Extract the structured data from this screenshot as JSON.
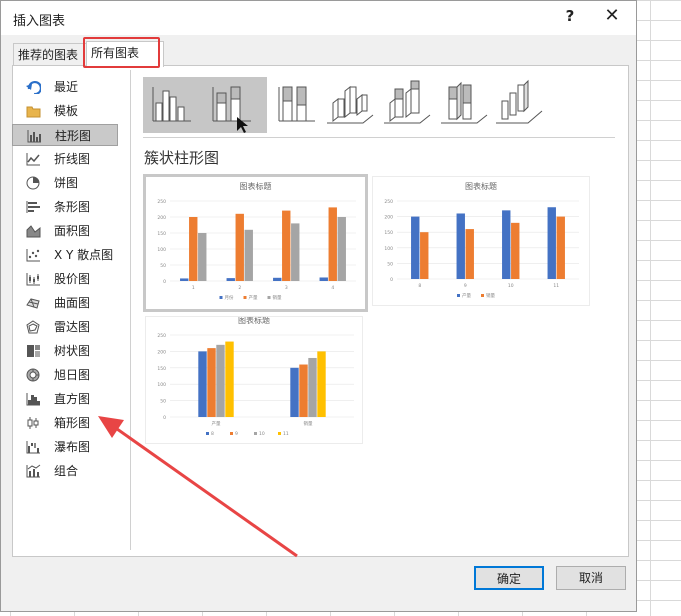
{
  "dialog": {
    "title": "插入图表",
    "help_label": "?",
    "close_label": "✕"
  },
  "tabs": [
    {
      "label": "推荐的图表",
      "selected": false
    },
    {
      "label": "所有图表",
      "selected": true
    }
  ],
  "sidebar": {
    "items": [
      {
        "label": "最近",
        "icon": "recent-icon"
      },
      {
        "label": "模板",
        "icon": "folder-icon"
      },
      {
        "label": "柱形图",
        "icon": "column-chart-icon",
        "selected": true
      },
      {
        "label": "折线图",
        "icon": "line-chart-icon"
      },
      {
        "label": "饼图",
        "icon": "pie-chart-icon"
      },
      {
        "label": "条形图",
        "icon": "bar-chart-icon"
      },
      {
        "label": "面积图",
        "icon": "area-chart-icon"
      },
      {
        "label": "X Y 散点图",
        "icon": "scatter-chart-icon"
      },
      {
        "label": "股价图",
        "icon": "stock-chart-icon"
      },
      {
        "label": "曲面图",
        "icon": "surface-chart-icon"
      },
      {
        "label": "雷达图",
        "icon": "radar-chart-icon"
      },
      {
        "label": "树状图",
        "icon": "treemap-chart-icon"
      },
      {
        "label": "旭日图",
        "icon": "sunburst-chart-icon"
      },
      {
        "label": "直方图",
        "icon": "histogram-chart-icon"
      },
      {
        "label": "箱形图",
        "icon": "boxplot-chart-icon"
      },
      {
        "label": "瀑布图",
        "icon": "waterfall-chart-icon"
      },
      {
        "label": "组合",
        "icon": "combo-chart-icon"
      }
    ]
  },
  "main": {
    "section_title": "簇状柱形图",
    "subtypes": [
      {
        "icon": "clustered-column-icon",
        "selected": true
      },
      {
        "icon": "stacked-column-icon",
        "selected": true
      },
      {
        "icon": "100-stacked-column-icon"
      },
      {
        "icon": "3d-clustered-column-icon"
      },
      {
        "icon": "3d-stacked-column-icon"
      },
      {
        "icon": "3d-100-stacked-column-icon"
      },
      {
        "icon": "3d-column-icon"
      }
    ],
    "previews": [
      {
        "title": "图表标题"
      },
      {
        "title": "图表标题"
      },
      {
        "title": "图表标题"
      }
    ]
  },
  "chart_data": [
    {
      "type": "bar",
      "title": "图表标题",
      "categories": [
        "1",
        "2",
        "3",
        "4"
      ],
      "series": [
        {
          "name": "月份",
          "color": "#4472c4",
          "values": [
            8,
            9,
            10,
            11
          ]
        },
        {
          "name": "产量",
          "color": "#ed7d31",
          "values": [
            200,
            210,
            220,
            230
          ]
        },
        {
          "name": "销量",
          "color": "#a5a5a5",
          "values": [
            150,
            160,
            180,
            200
          ]
        }
      ],
      "yticks": [
        "0",
        "50",
        "100",
        "150",
        "200",
        "250"
      ],
      "ylim": [
        0,
        250
      ]
    },
    {
      "type": "bar",
      "title": "图表标题",
      "categories": [
        "8",
        "9",
        "10",
        "11"
      ],
      "series": [
        {
          "name": "产量",
          "color": "#4472c4",
          "values": [
            200,
            210,
            220,
            230
          ]
        },
        {
          "name": "销量",
          "color": "#ed7d31",
          "values": [
            150,
            160,
            180,
            200
          ]
        }
      ],
      "yticks": [
        "0",
        "50",
        "100",
        "150",
        "200",
        "250"
      ],
      "ylim": [
        0,
        250
      ]
    },
    {
      "type": "bar",
      "title": "图表标题",
      "categories": [
        "产量",
        "销量"
      ],
      "series": [
        {
          "name": "8",
          "color": "#4472c4",
          "values": [
            200,
            150
          ]
        },
        {
          "name": "9",
          "color": "#ed7d31",
          "values": [
            210,
            160
          ]
        },
        {
          "name": "10",
          "color": "#a5a5a5",
          "values": [
            220,
            180
          ]
        },
        {
          "name": "11",
          "color": "#ffc000",
          "values": [
            230,
            200
          ]
        }
      ],
      "yticks": [
        "0",
        "50",
        "100",
        "150",
        "200",
        "250"
      ],
      "ylim": [
        0,
        250
      ]
    }
  ],
  "buttons": {
    "ok_label": "确定",
    "cancel_label": "取消"
  },
  "colors": {
    "accent": "#0078d7",
    "highlight_red": "#e23b3b"
  }
}
